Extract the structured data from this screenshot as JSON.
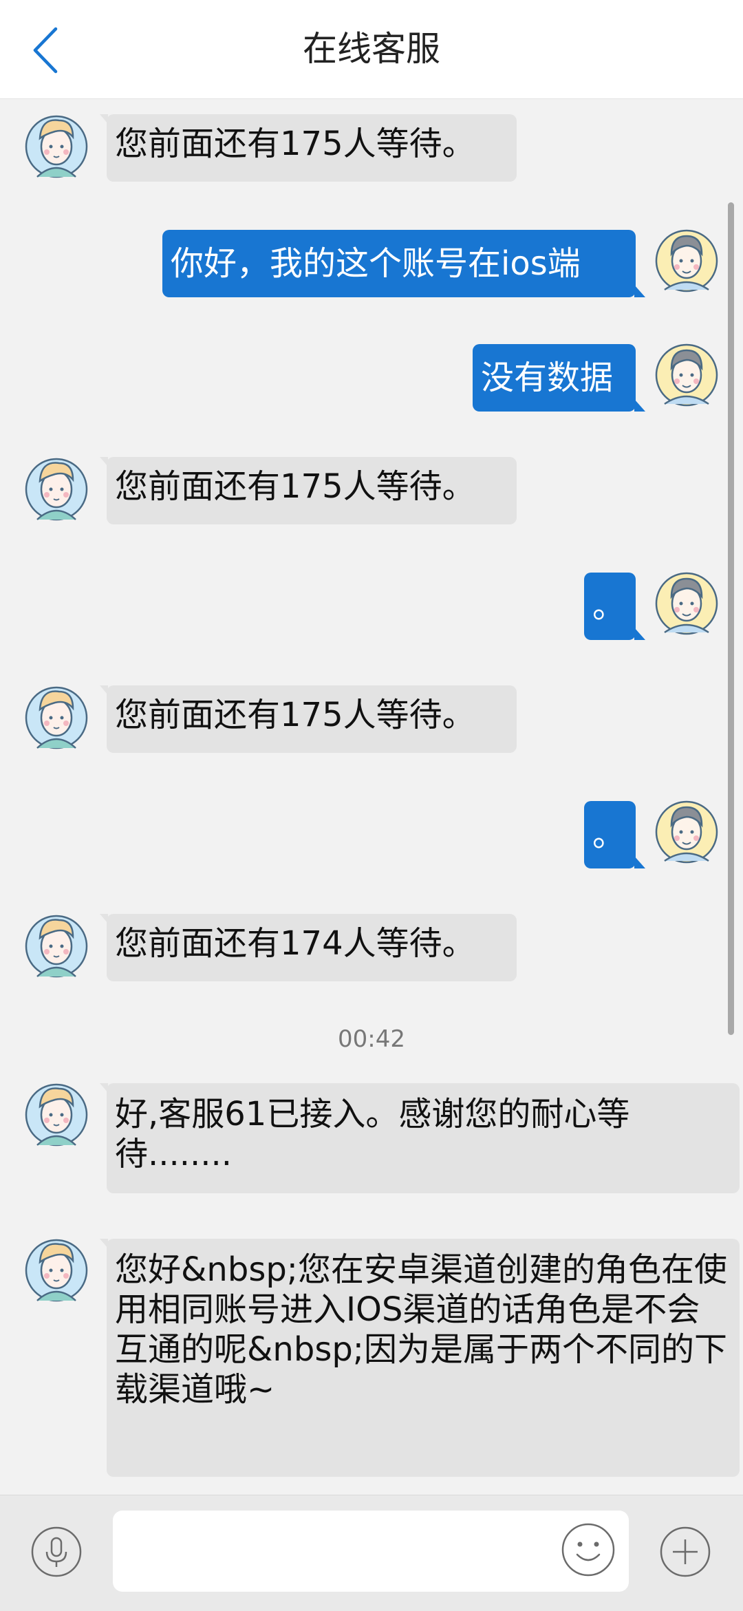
{
  "header": {
    "title": "在线客服"
  },
  "messages": [
    {
      "side": "in",
      "text": "您前面还有175人等待。"
    },
    {
      "side": "out",
      "text": "你好，我的这个账号在ios端"
    },
    {
      "side": "out",
      "text": "没有数据"
    },
    {
      "side": "in",
      "text": "您前面还有175人等待。"
    },
    {
      "side": "out",
      "text": "。"
    },
    {
      "side": "in",
      "text": "您前面还有175人等待。"
    },
    {
      "side": "out",
      "text": "。"
    },
    {
      "side": "in",
      "text": "您前面还有174人等待。"
    },
    {
      "side": "in",
      "text": "好,客服61已接入。感谢您的耐心等待........"
    },
    {
      "side": "in",
      "text": "您好&nbsp;您在安卓渠道创建的角色在使用相同账号进入IOS渠道的话角色是不会互通的呢&nbsp;因为是属于两个不同的下载渠道哦~"
    }
  ],
  "timestamp": "00:42",
  "input": {
    "placeholder": "",
    "value": ""
  },
  "colors": {
    "accent": "#1876d2",
    "incoming_bubble": "#e3e3e3",
    "background": "#f2f2f2"
  },
  "icons": {
    "back": "chevron-left-icon",
    "mic": "microphone-icon",
    "emoji": "smiley-icon",
    "plus": "plus-icon"
  }
}
